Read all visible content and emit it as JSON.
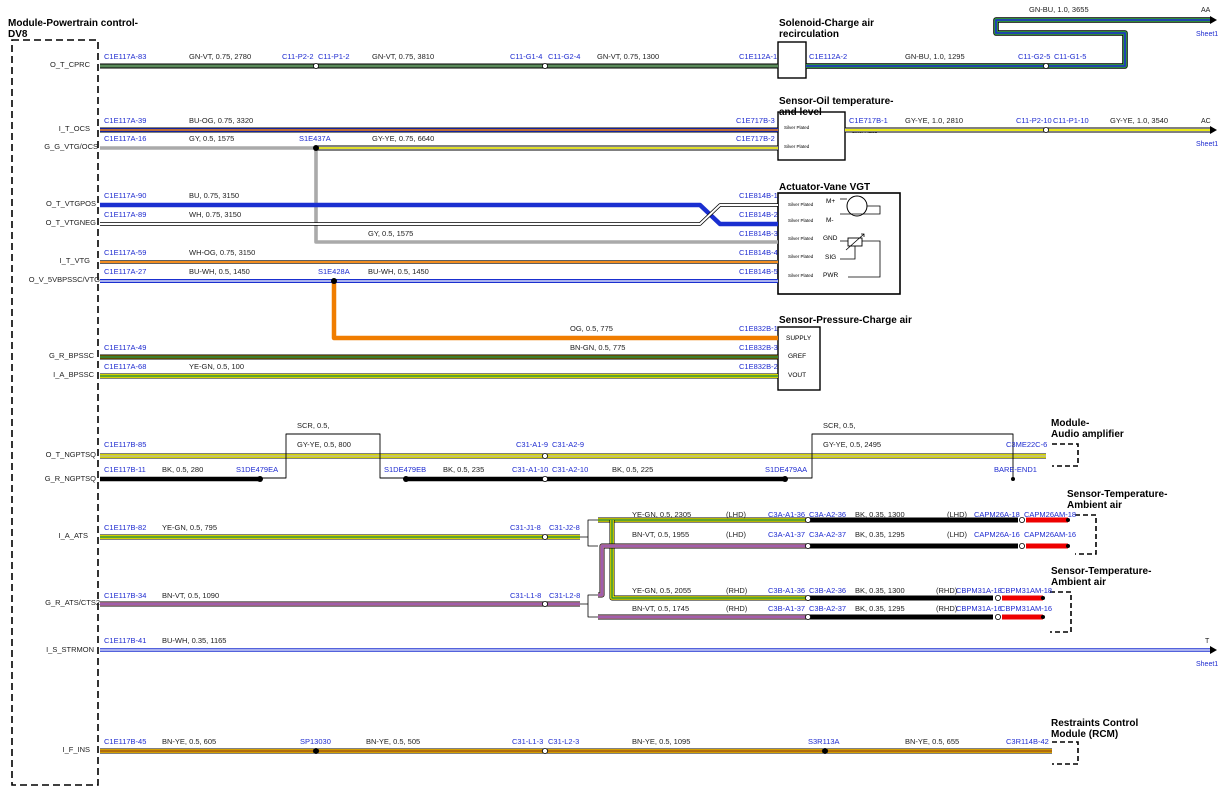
{
  "modules": {
    "pcm": {
      "title_line1": "Module-Powertrain control-",
      "title_line2": "DV8"
    },
    "cac_sol": {
      "title_line1": "Solenoid-Charge air",
      "title_line2": "recirculation"
    },
    "oil": {
      "title_line1": "Sensor-Oil temperature-",
      "title_line2": "and level",
      "silver1": "Silver Plated",
      "silver2": "Silver Plated",
      "silver3": "Silver Plated"
    },
    "vgt": {
      "title": "Actuator-Vane VGT",
      "silver": "Silver Plated",
      "pins": [
        "M+",
        "M-",
        "GND",
        "SIG",
        "PWR"
      ]
    },
    "cap": {
      "title": "Sensor-Pressure-Charge air",
      "pins": [
        "SUPPLY",
        "GREF",
        "VOUT"
      ]
    },
    "amp": {
      "title_line1": "Module-",
      "title_line2": "Audio amplifier"
    },
    "ats1": {
      "title_line1": "Sensor-Temperature-",
      "title_line2": "Ambient air"
    },
    "ats2": {
      "title_line1": "Sensor-Temperature-",
      "title_line2": "Ambient air"
    },
    "rcm": {
      "title_line1": "Restraints Control",
      "title_line2": "Module (RCM)"
    }
  },
  "signals": [
    "O_T_CPRC",
    "I_T_OCS",
    "G_G_VTG/OCS",
    "O_T_VTGPOS",
    "O_T_VTGNEG",
    "I_T_VTG",
    "O_V_5VBPSSC/VTG",
    "G_R_BPSSC",
    "I_A_BPSSC",
    "O_T_NGPTSQ",
    "G_R_NGPTSQ",
    "I_A_ATS",
    "G_R_ATS/CTS2",
    "I_S_STRMON",
    "I_F_INS"
  ],
  "connectors": {
    "r1": [
      "C1E117A-83",
      "C11-P2-2",
      "C11-P1-2",
      "C11-G1-4",
      "C11-G2-4",
      "C1E112A-1",
      "C1E112A-2",
      "C11-G2-5",
      "C11-G1-5"
    ],
    "r2": [
      "C1E117A-39",
      "C1E717B-3",
      "C1E717B-1",
      "C11-P2-10",
      "C11-P1-10"
    ],
    "r3": [
      "C1E117A-16",
      "S1E437A",
      "C1E717B-2"
    ],
    "r4": [
      "C1E117A-90",
      "C1E814B-1"
    ],
    "r5": [
      "C1E117A-89",
      "C1E814B-2"
    ],
    "r5b": [
      "C1E814B-3"
    ],
    "r6": [
      "C1E117A-59",
      "C1E814B-4"
    ],
    "r7": [
      "C1E117A-27",
      "S1E428A",
      "C1E814B-5"
    ],
    "r8": [
      "C1E832B-1"
    ],
    "r9": [
      "C1E117A-49",
      "C1E832B-3"
    ],
    "r10": [
      "C1E117A-68",
      "C1E832B-2"
    ],
    "r11": [
      "C1E117B-85",
      "C31-A1-9",
      "C31-A2-9",
      "C3ME22C-6"
    ],
    "r12": [
      "C1E117B-11",
      "S1DE479EA",
      "S1DE479EB",
      "C31-A1-10",
      "C31-A2-10",
      "S1DE479AA",
      "BARE-END1"
    ],
    "r13": [
      "C1E117B-82",
      "C31-J1-8",
      "C31-J2-8"
    ],
    "lhd1": [
      "C3A-A1-36",
      "C3A-A2-36",
      "CAPM26A-18",
      "CAPM26AM-18"
    ],
    "lhd2": [
      "C3A-A1-37",
      "C3A-A2-37",
      "CAPM26A-16",
      "CAPM26AM-16"
    ],
    "r14": [
      "C1E117B-34",
      "C31-L1-8",
      "C31-L2-8"
    ],
    "rhd1": [
      "C3B-A1-36",
      "C3B-A2-36",
      "CBPM31A-18",
      "CBPM31AM-18"
    ],
    "rhd2": [
      "C3B-A1-37",
      "C3B-A2-37",
      "CBPM31A-16",
      "CBPM31AM-16"
    ],
    "r15": [
      "C1E117B-41"
    ],
    "r16": [
      "C1E117B-45",
      "SP13030",
      "C31-L1-3",
      "C31-L2-3",
      "S3R113A",
      "C3R114B-42"
    ]
  },
  "wires": {
    "r1": [
      "GN-VT, 0.75, 2780",
      "GN-VT, 0.75, 3810",
      "GN-VT, 0.75, 1300",
      "GN-BU, 1.0, 1295",
      "GN-BU, 1.0, 3655"
    ],
    "r2": [
      "BU-OG, 0.75, 3320",
      "GY-YE, 1.0, 2810",
      "GY-YE, 1.0, 3540"
    ],
    "r3": [
      "GY, 0.5, 1575",
      "GY-YE, 0.75, 6640"
    ],
    "r4": [
      "BU, 0.75, 3150"
    ],
    "r5": [
      "WH, 0.75, 3150"
    ],
    "r5b": [
      "GY, 0.5, 1575"
    ],
    "r6": [
      "WH-OG, 0.75, 3150"
    ],
    "r7": [
      "BU-WH, 0.5, 1450",
      "BU-WH, 0.5, 1450"
    ],
    "r8": [
      "OG, 0.5, 775"
    ],
    "r9": [
      "BN-GN, 0.5, 775"
    ],
    "r10": [
      "YE-GN, 0.5, 100"
    ],
    "r11": [
      "SCR, 0.5,",
      "GY-YE, 0.5, 800",
      "SCR, 0.5,",
      "GY-YE, 0.5, 2495"
    ],
    "r12": [
      "BK, 0.5, 280",
      "BK, 0.5, 235",
      "BK, 0.5, 225"
    ],
    "r13": [
      "YE-GN, 0.5, 795"
    ],
    "lhd1": [
      "YE-GN, 0.5, 2305",
      "BK, 0.35, 1300"
    ],
    "lhd2": [
      "BN-VT, 0.5, 1955",
      "BK, 0.35, 1295"
    ],
    "r14": [
      "BN-VT, 0.5, 1090"
    ],
    "rhd1": [
      "YE-GN, 0.5, 2055",
      "BK, 0.35, 1300"
    ],
    "rhd2": [
      "BN-VT, 0.5, 1745",
      "BK, 0.35, 1295"
    ],
    "r15": [
      "BU-WH, 0.35, 1165"
    ],
    "r16": [
      "BN-YE, 0.5, 605",
      "BN-YE, 0.5, 505",
      "BN-YE, 0.5, 1095",
      "BN-YE, 0.5, 655"
    ]
  },
  "variants": {
    "lhd": "(LHD)",
    "rhd": "(RHD)"
  },
  "offsheet": [
    {
      "tag": "AA",
      "sheet": "Sheet1"
    },
    {
      "tag": "AC",
      "sheet": "Sheet1"
    },
    {
      "tag": "T",
      "sheet": "Sheet1"
    }
  ],
  "colors": {
    "GN": "#2e8b3a",
    "VT": "#9b59b6",
    "BU": "#1a2fd0",
    "OG": "#f07d00",
    "GY": "#aaaaaa",
    "YE": "#f2f000",
    "WH": "#ffffff",
    "BK": "#000000",
    "BN": "#8b4513",
    "RD": "#ee0000",
    "connector": "#1e2bd0"
  }
}
